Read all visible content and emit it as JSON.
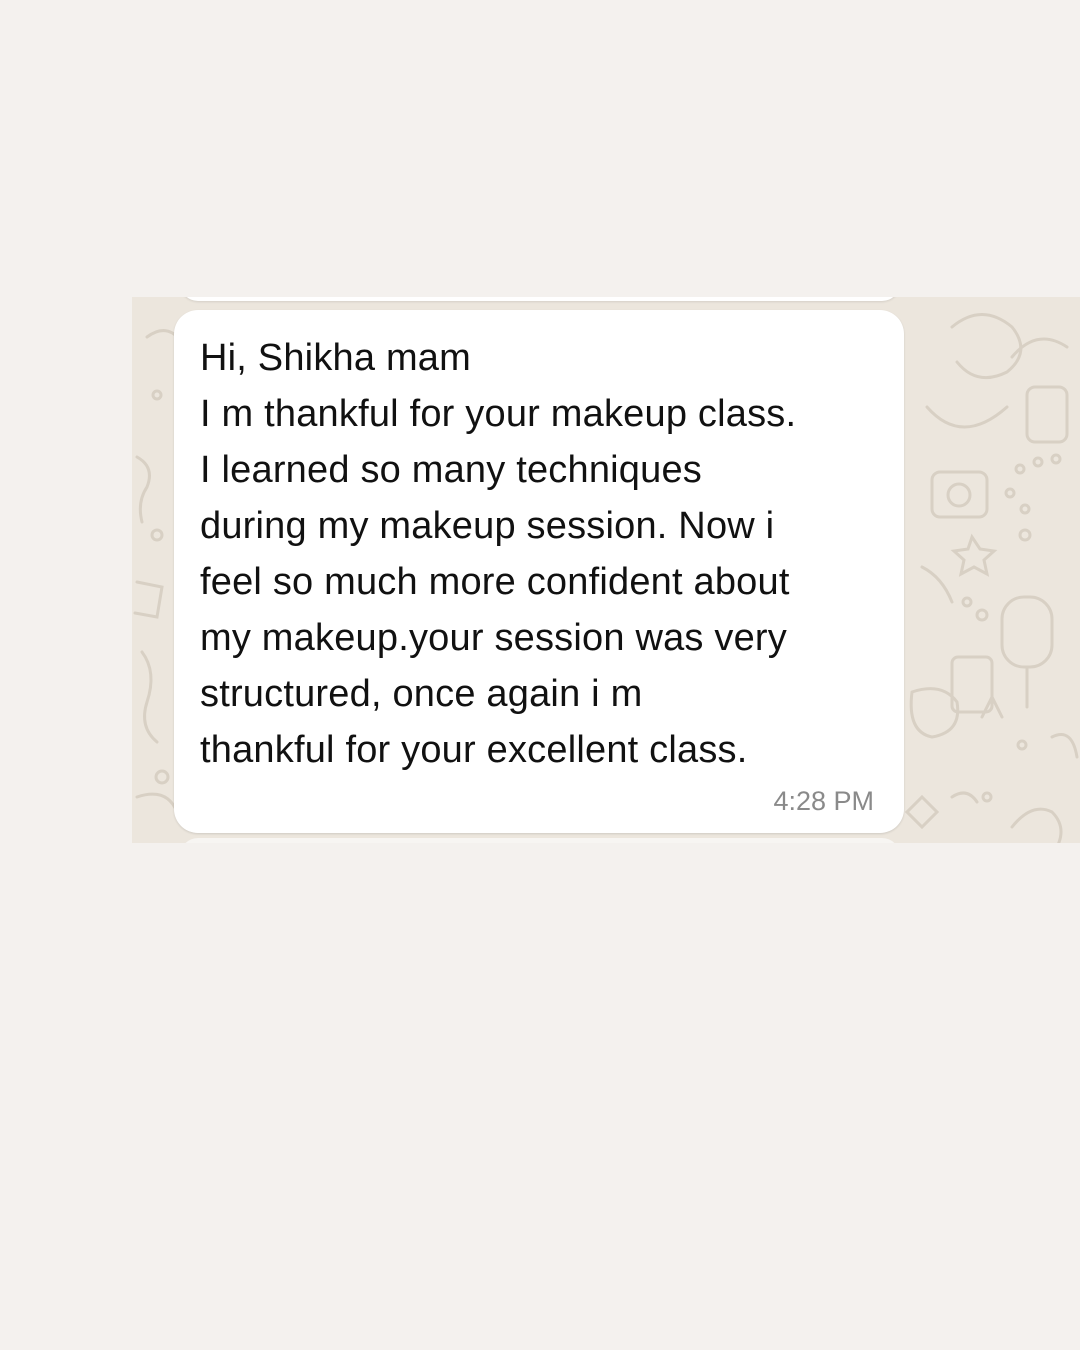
{
  "chat": {
    "message": {
      "text": "Hi, Shikha mam\nI m thankful for your makeup class.\nI learned so many techniques\nduring my makeup session. Now i\nfeel so much more confident about\nmy makeup.your session was very\nstructured, once again  i m\nthankful for your excellent class.",
      "time": "4:28 PM"
    }
  },
  "colors": {
    "page_background": "#f4f1ee",
    "chat_wallpaper": "#ece6dd",
    "bubble": "#ffffff",
    "message_text": "#111111",
    "timestamp": "#8a8a8a"
  }
}
